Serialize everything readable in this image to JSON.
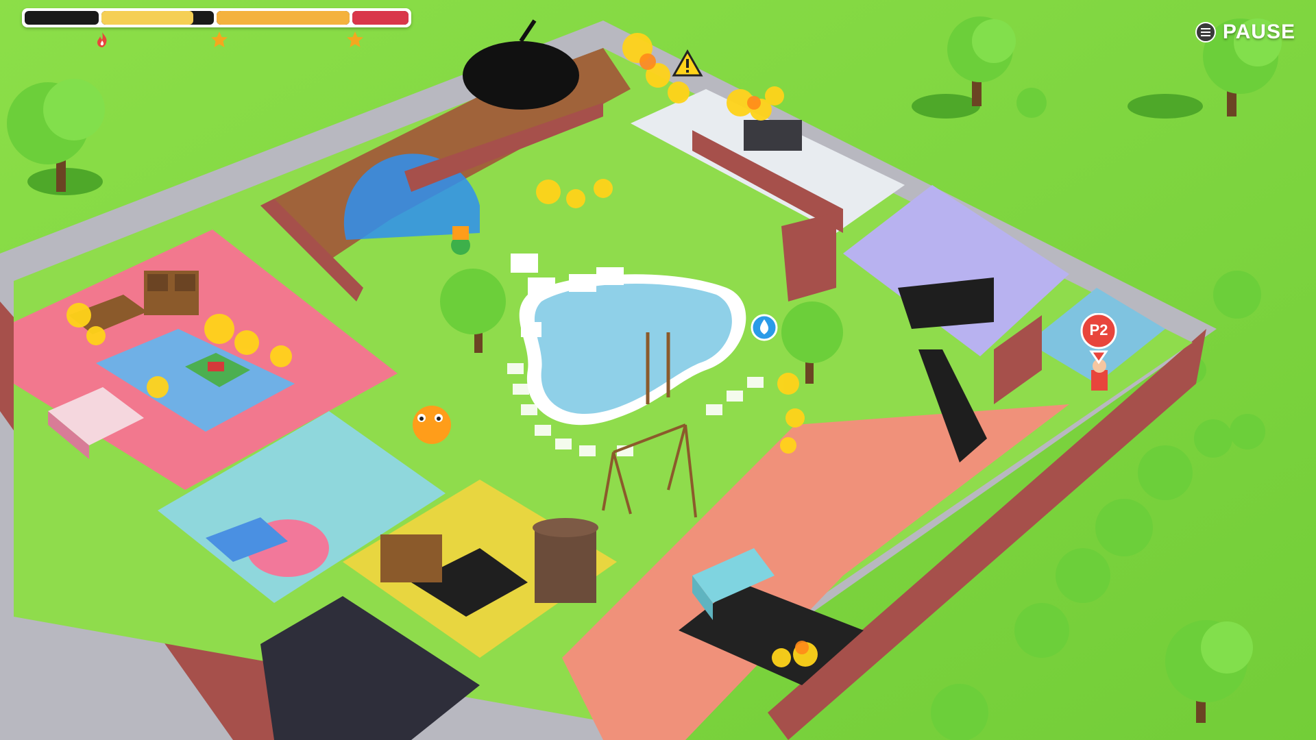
{
  "hud": {
    "segments": [
      {
        "fill": 0.0,
        "color": "#1a1a1a"
      },
      {
        "fill": 0.82,
        "color": "#f5cf55"
      },
      {
        "fill": 1.0,
        "color": "#f4b23e"
      },
      {
        "fill": 1.0,
        "color": "#d9364a"
      }
    ],
    "icons": [
      "fire-icon",
      "star-icon",
      "star-icon"
    ],
    "colors": {
      "fire": "#e8453c",
      "star": "#f4a71f"
    }
  },
  "pause": {
    "label": "PAUSE",
    "icon": "menu-icon"
  },
  "player2": {
    "label": "P2",
    "color": "#e8453c"
  },
  "scene": {
    "grass": "#7fd93f",
    "pool_water": "#8fd0e8",
    "hazard_icon": "warning-icon",
    "water_drop_icon": "water-drop-icon"
  }
}
